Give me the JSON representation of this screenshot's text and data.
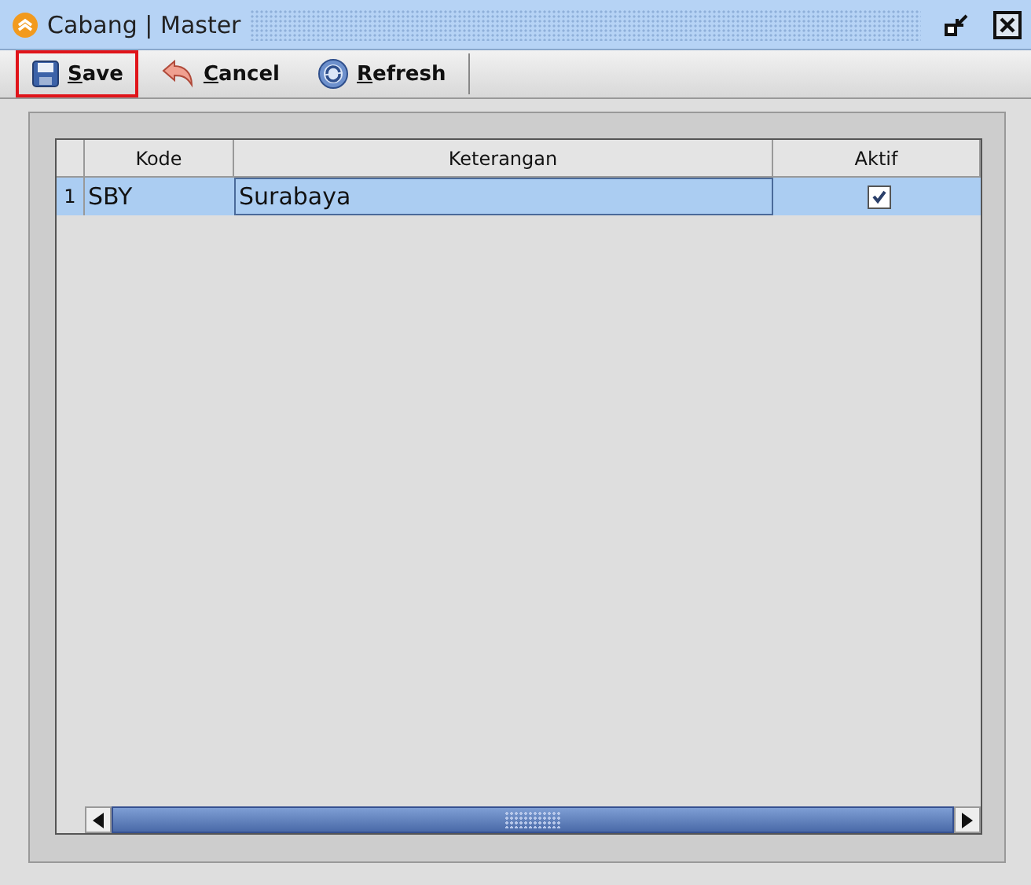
{
  "window": {
    "title": "Cabang | Master"
  },
  "toolbar": [
    {
      "kind": "save",
      "label": "Save",
      "highlighted": true
    },
    {
      "kind": "cancel",
      "label": "Cancel",
      "highlighted": false
    },
    {
      "kind": "refresh",
      "label": "Refresh",
      "highlighted": false
    }
  ],
  "table": {
    "columns": [
      "Kode",
      "Keterangan",
      "Aktif"
    ],
    "rows": [
      {
        "number": "1",
        "kode": "SBY",
        "keterangan": "Surabaya",
        "aktif": true,
        "selected": true
      }
    ]
  }
}
